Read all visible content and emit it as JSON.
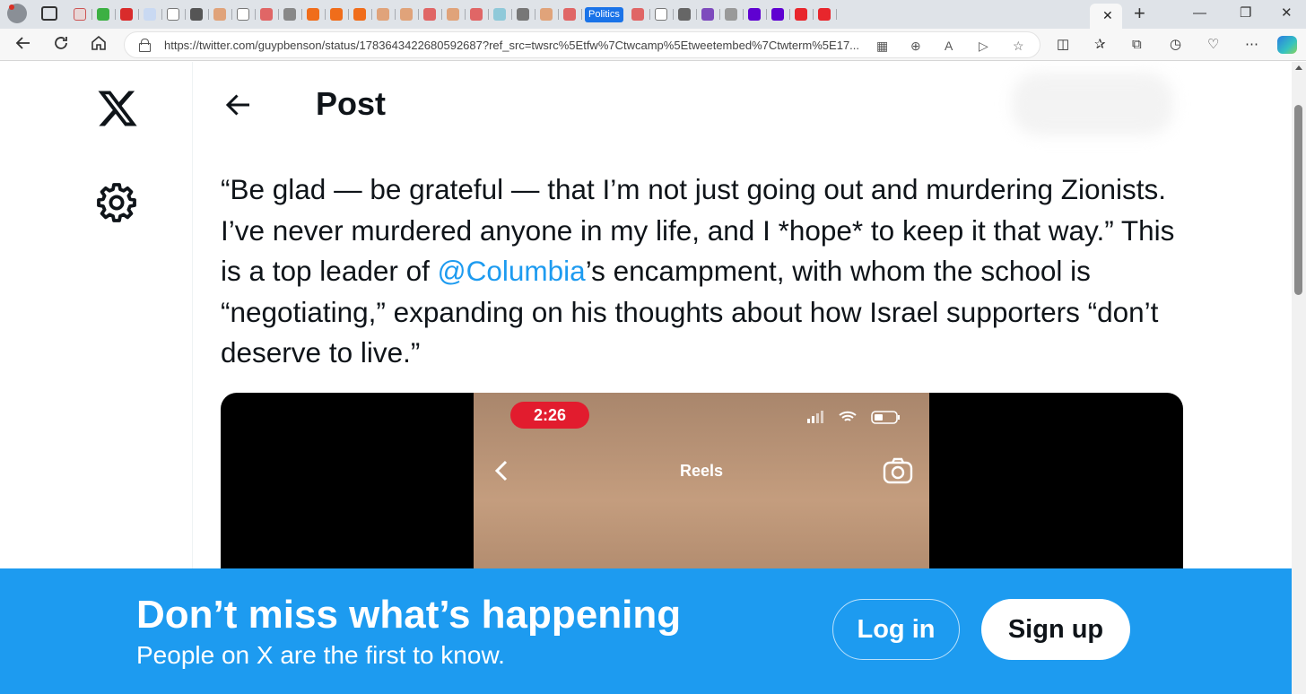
{
  "browser": {
    "url": "https://twitter.com/guypbenson/status/1783643422680592687?ref_src=twsrc%5Etfw%7Ctwcamp%5Etweetembed%7Ctwterm%5E17...",
    "politics_tab_label": "Politics",
    "new_tab_label": "+",
    "close_tab_label": "✕",
    "minimize_label": "—",
    "restore_label": "❐",
    "close_window_label": "✕"
  },
  "colors": {
    "brand_blue": "#1d9bf0",
    "text_primary": "#0f1419",
    "recording_red": "#e21c2e"
  },
  "header": {
    "title": "Post"
  },
  "tweet": {
    "text_before_mention": "“Be glad — be grateful — that I’m not just going out and murdering Zionists. I’ve never murdered anyone in my life, and I *hope* to keep it that way.” This is a top leader of ",
    "mention": "@Columbia",
    "text_after_mention": "’s encampment, with whom the school is “negotiating,” expanding on his thoughts about how Israel supporters “don’t deserve to live.”"
  },
  "media": {
    "time": "2:26",
    "screen_title": "Reels"
  },
  "banner": {
    "title": "Don’t miss what’s happening",
    "subtitle": "People on X are the first to know.",
    "login_label": "Log in",
    "signup_label": "Sign up"
  }
}
